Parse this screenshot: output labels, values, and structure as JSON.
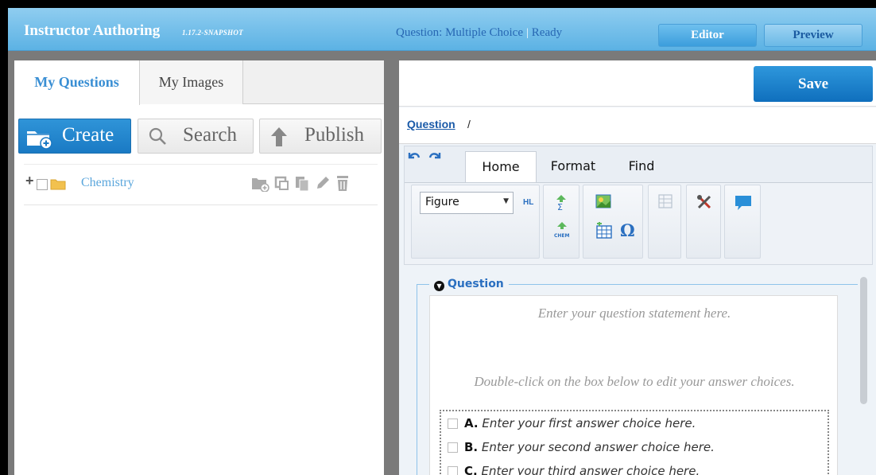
{
  "header": {
    "app_title": "Instructor Authoring",
    "app_version": "1.17.2-SNAPSHOT",
    "status_type": "Question: Multiple Choice",
    "status_separator": "|",
    "status_state": "Ready",
    "editor_label": "Editor",
    "preview_label": "Preview"
  },
  "left": {
    "tabs": [
      {
        "label": "My Questions",
        "active": true
      },
      {
        "label": "My Images",
        "active": false
      }
    ],
    "actions": {
      "create": "Create",
      "search": "Search",
      "publish": "Publish"
    },
    "folders": [
      {
        "expand": "+",
        "name": "Chemistry"
      }
    ]
  },
  "right": {
    "save_label": "Save",
    "breadcrumb_link": "Question",
    "breadcrumb_sep": "/",
    "ribbon": {
      "tabs": [
        "Home",
        "Format",
        "Find"
      ],
      "active_tab": "Home",
      "style_select": "Figure",
      "hl_label": "HL",
      "chem_label": "CHEM",
      "omega_label": "Ω"
    },
    "question": {
      "legend": "Question",
      "statement_placeholder": "Enter your question statement here.",
      "hint": "Double-click on the box below to edit your answer choices.",
      "choices": [
        {
          "letter": "A.",
          "text": "Enter your first answer choice here."
        },
        {
          "letter": "B.",
          "text": "Enter your second answer choice here."
        },
        {
          "letter": "C.",
          "text": "Enter your third answer choice here."
        }
      ]
    }
  },
  "colors": {
    "header_blue": "#5cb2e4",
    "accent_blue": "#1a7ac4",
    "link_blue": "#2a6fc0"
  },
  "icons": [
    "folder-add-icon",
    "search-icon",
    "upload-arrow-icon",
    "folder-icon",
    "undo-icon",
    "redo-icon",
    "sigma-icon",
    "chem-icon",
    "image-icon",
    "table-icon",
    "omega-icon",
    "grid-icon",
    "tools-icon",
    "comment-icon",
    "collapse-icon"
  ]
}
